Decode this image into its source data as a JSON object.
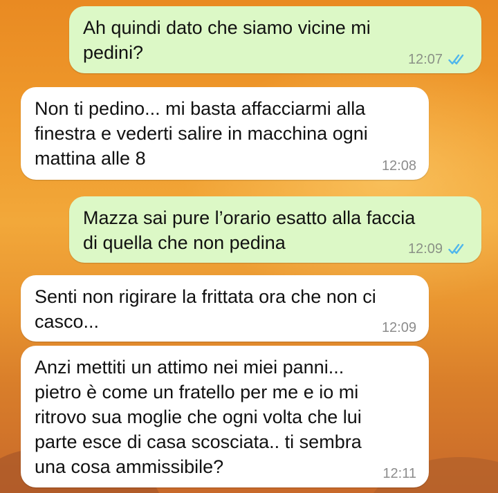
{
  "theme": {
    "outgoing_bubble": "#dcf8c6",
    "incoming_bubble": "#ffffff",
    "read_tick": "#4fb6ec"
  },
  "messages": [
    {
      "direction": "outgoing",
      "text": "Ah quindi dato che siamo vicine mi\npedini?",
      "time": "12:07",
      "status_icon": "double-check-read-icon"
    },
    {
      "direction": "incoming",
      "text": "Non ti pedino... mi basta affacciarmi alla\nfinestra e vederti salire in macchina ogni\nmattina alle 8",
      "time": "12:08"
    },
    {
      "direction": "outgoing",
      "text": "Mazza sai pure l’orario esatto alla faccia\ndi quella che non pedina",
      "time": "12:09",
      "status_icon": "double-check-read-icon"
    },
    {
      "direction": "incoming",
      "text": "Senti non rigirare la frittata ora che non ci\ncasco...",
      "time": "12:09"
    },
    {
      "direction": "incoming",
      "text": "Anzi mettiti un attimo nei miei panni...\npietro è come un fratello per me e io mi\nritrovo sua moglie che ogni volta che lui\nparte esce di casa scosciata.. ti sembra\nuna cosa ammissibile?",
      "time": "12:11"
    }
  ]
}
